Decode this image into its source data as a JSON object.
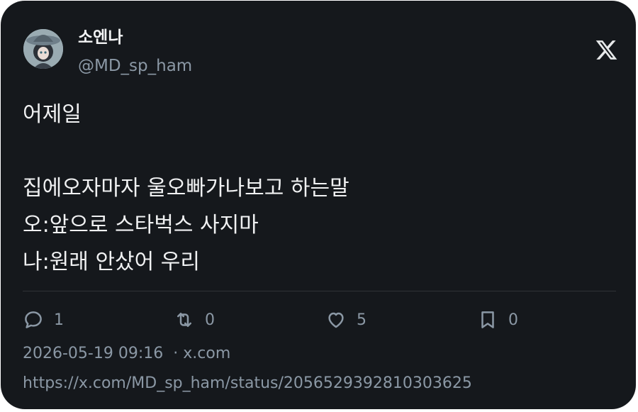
{
  "author": {
    "display_name": "소엔나",
    "handle": "@MD_sp_ham"
  },
  "brand_icon": "x-logo-icon",
  "tweet": {
    "lines": [
      "어제일",
      "",
      "집에오자마자 울오빠가나보고 하는말",
      "오:앞으로 스타벅스 사지마",
      "나:원래 안샀어 우리"
    ]
  },
  "actions": {
    "reply": {
      "icon": "reply-icon",
      "count": "1"
    },
    "repost": {
      "icon": "repost-icon",
      "count": "0"
    },
    "like": {
      "icon": "heart-icon",
      "count": "5"
    },
    "bookmark": {
      "icon": "bookmark-icon",
      "count": "0"
    }
  },
  "meta": {
    "timestamp": "2026-05-19 09:16",
    "separator": "·",
    "source": "x.com"
  },
  "status_url": "https://x.com/MD_sp_ham/status/2056529392810303625",
  "colors": {
    "card_background": "#15181c",
    "primary_text": "#e7e9ea",
    "secondary_text": "#8b98a5",
    "divider": "#2f3336"
  }
}
